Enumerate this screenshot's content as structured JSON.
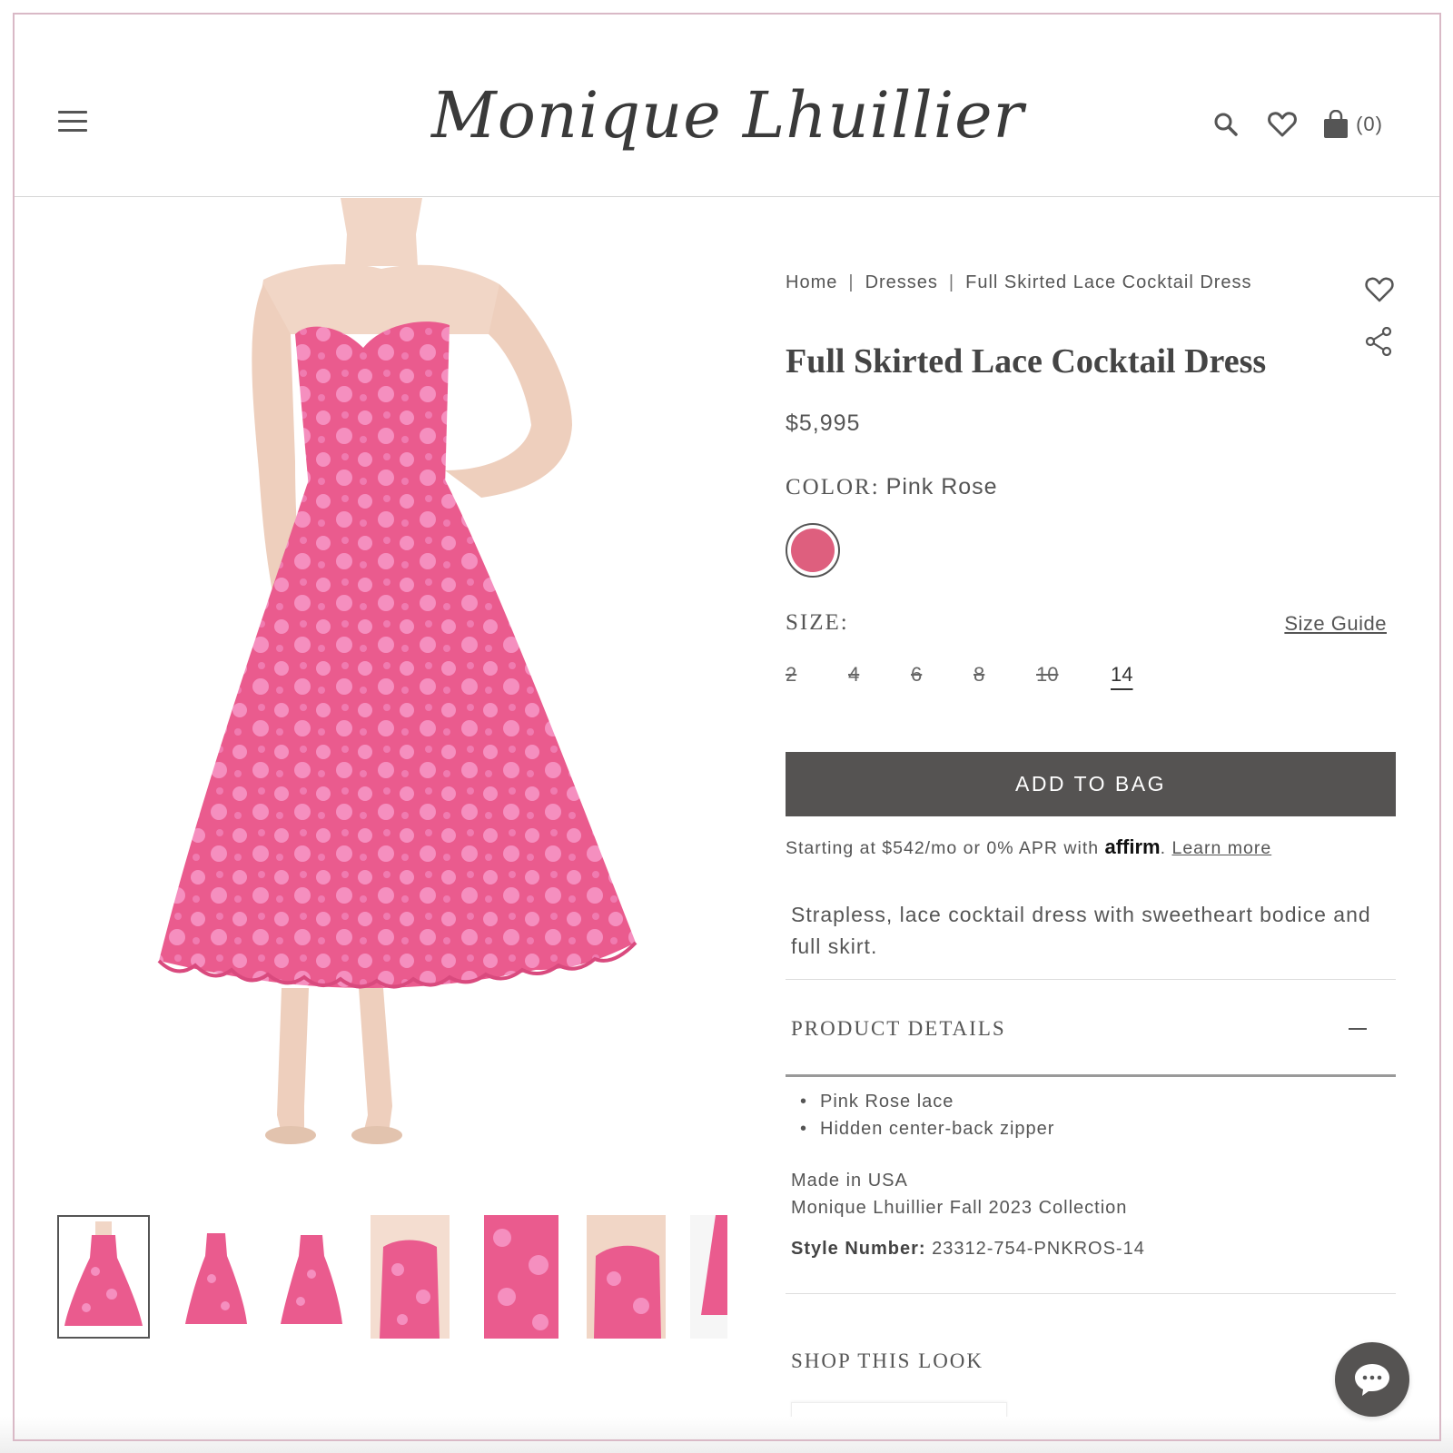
{
  "header": {
    "logo_text": "Monique Lhuillier",
    "cart_count": "(0)",
    "icons": [
      "menu-icon",
      "search-icon",
      "heart-icon",
      "shopping-bag-icon"
    ]
  },
  "breadcrumb": {
    "home": "Home",
    "category": "Dresses",
    "current": "Full Skirted Lace Cocktail Dress",
    "separator": "|"
  },
  "product": {
    "title": "Full Skirted Lace Cocktail Dress",
    "price": "$5,995",
    "color_caption": "COLOR:",
    "color_value": "Pink Rose",
    "swatch_color": "#de5f7e",
    "size_caption": "SIZE:",
    "size_guide": "Size Guide",
    "sizes": [
      {
        "label": "2",
        "available": false
      },
      {
        "label": "4",
        "available": false
      },
      {
        "label": "6",
        "available": false
      },
      {
        "label": "8",
        "available": false
      },
      {
        "label": "10",
        "available": false
      },
      {
        "label": "14",
        "available": true
      }
    ],
    "add_to_bag": "ADD TO BAG",
    "financing": {
      "prefix": "Starting at $542/mo or 0% APR with",
      "brand": "affirm",
      "suffix": ".",
      "learn_more": "Learn more"
    },
    "description": "Strapless, lace cocktail dress with sweetheart bodice and full skirt.",
    "details_title": "PRODUCT DETAILS",
    "details_bullets": [
      "Pink Rose lace",
      "Hidden center-back zipper"
    ],
    "made_in": "Made in USA",
    "collection": "Monique Lhuillier Fall 2023 Collection",
    "style_label": "Style Number:",
    "style_number": "23312-754-PNKROS-14",
    "shop_look": "SHOP THIS LOOK"
  },
  "colors": {
    "dress_pink": "#ea5b8e",
    "lace_light": "#f58fbf",
    "button_dark": "#555352"
  }
}
